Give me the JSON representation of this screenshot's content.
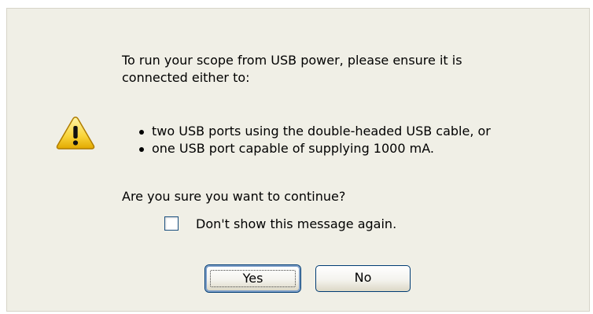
{
  "dialog": {
    "icon": "warning-icon",
    "message": {
      "intro": "To run your scope from USB power, please ensure it is connected either to:",
      "bullets": [
        "two USB ports using the double-headed USB cable, or",
        "one USB port capable of supplying 1000 mA."
      ],
      "question": "Are you sure you want to continue?"
    },
    "checkbox": {
      "label": "Don't show this message again.",
      "checked": false
    },
    "buttons": {
      "yes_label": "Yes",
      "no_label": "No"
    }
  },
  "colors": {
    "dialog_background": "#f0efe6",
    "button_border": "#003c74",
    "warning_yellow": "#f9d43a"
  }
}
